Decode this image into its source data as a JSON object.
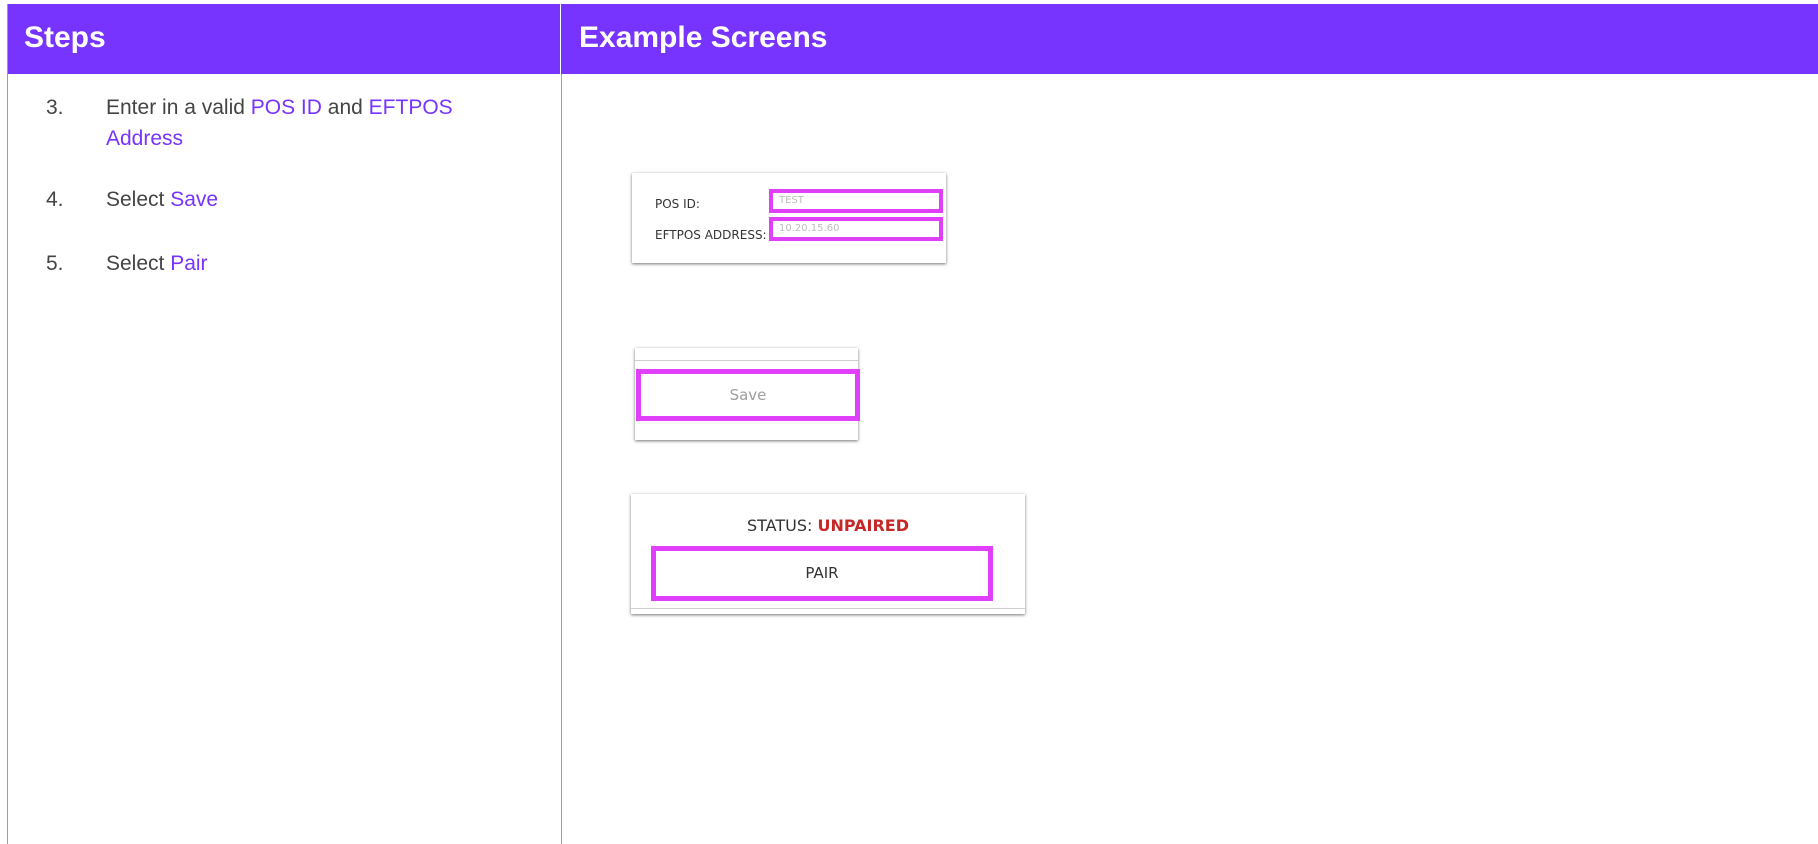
{
  "header": {
    "steps_title": "Steps",
    "examples_title": "Example Screens"
  },
  "steps": [
    {
      "num": "3.",
      "pre": "Enter in a valid ",
      "hl1": "POS ID",
      "mid": " and ",
      "hl2": "EFTPOS Address"
    },
    {
      "num": "4.",
      "pre": "Select ",
      "hl1": "Save"
    },
    {
      "num": "5.",
      "pre": "Select ",
      "hl1": "Pair"
    }
  ],
  "screens": {
    "form": {
      "pos_id_label": "POS ID:",
      "pos_id_value": "TEST",
      "eftpos_label": "EFTPOS ADDRESS:",
      "eftpos_value": "10.20.15.60"
    },
    "save": {
      "button_label": "Save"
    },
    "pairing": {
      "status_label": "STATUS:",
      "status_value": "UNPAIRED",
      "button_label": "PAIR"
    }
  },
  "colors": {
    "header_bg": "#7733ff",
    "highlight_text": "#7733ff",
    "callout_border": "#e040fb",
    "status_unpaired": "#c62828"
  }
}
